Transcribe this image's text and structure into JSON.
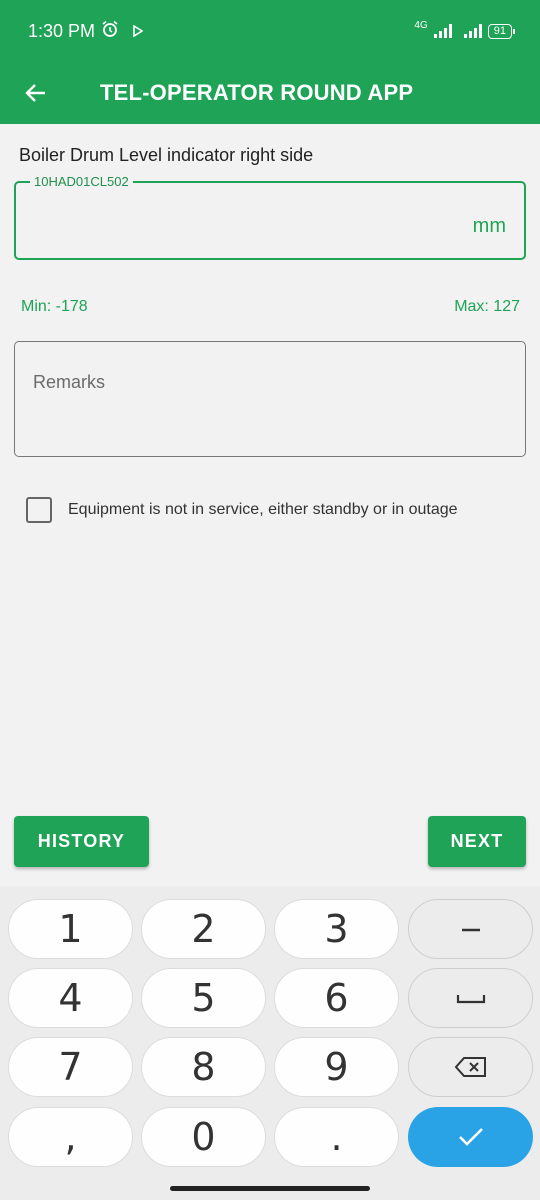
{
  "status_bar": {
    "time": "1:30 PM",
    "network": "4G",
    "battery": "91"
  },
  "app_bar": {
    "title": "TEL-OPERATOR ROUND APP"
  },
  "form": {
    "field_title": "Boiler Drum Level indicator right side",
    "tag": "10HAD01CL502",
    "value": "",
    "unit": "mm",
    "min": "Min: -178",
    "max": "Max: 127",
    "remarks_placeholder": "Remarks",
    "remarks_value": "",
    "checkbox_label": "Equipment is not in service, either standby or in outage",
    "checkbox_checked": false
  },
  "buttons": {
    "history": "HISTORY",
    "next": "NEXT"
  },
  "keyboard": {
    "keys": [
      "1",
      "2",
      "3",
      "4",
      "5",
      "6",
      "7",
      "8",
      "9",
      ",",
      "0",
      "."
    ],
    "fn_icons": [
      "minus-icon",
      "space-icon",
      "backspace-icon",
      "checkmark-icon"
    ]
  },
  "colors": {
    "primary": "#1fa356",
    "accent_blue": "#2aa3e6"
  }
}
